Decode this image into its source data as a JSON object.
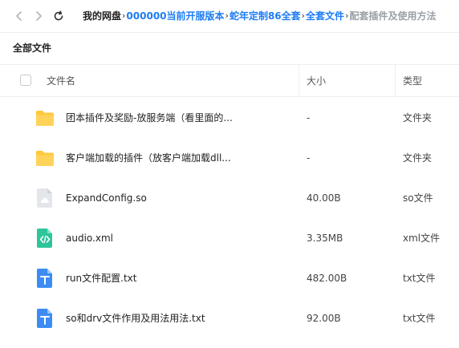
{
  "nav": {
    "back_icon": "chevron-left-icon",
    "forward_icon": "chevron-right-icon",
    "refresh_icon": "refresh-icon",
    "separator": "›",
    "breadcrumb": {
      "root": "我的网盘",
      "items": [
        "000000当前开服版本",
        "蛇年定制86全套",
        "全套文件"
      ],
      "current": "配套插件及使用方法"
    }
  },
  "section_title": "全部文件",
  "table": {
    "headers": {
      "name": "文件名",
      "size": "大小",
      "type": "类型"
    },
    "rows": [
      {
        "icon": "folder-icon",
        "name": "团本插件及奖励-放服务端（看里面的...",
        "size": "-",
        "type": "文件夹"
      },
      {
        "icon": "folder-icon",
        "name": "客户端加载的插件（放客户端加载dll...",
        "size": "-",
        "type": "文件夹"
      },
      {
        "icon": "generic-file-icon",
        "name": "ExpandConfig.so",
        "size": "40.00B",
        "type": "so文件"
      },
      {
        "icon": "code-file-icon",
        "name": "audio.xml",
        "size": "3.35MB",
        "type": "xml文件"
      },
      {
        "icon": "text-file-icon",
        "name": "run文件配置.txt",
        "size": "482.00B",
        "type": "txt文件"
      },
      {
        "icon": "text-file-icon",
        "name": "so和drv文件作用及用法用法.txt",
        "size": "92.00B",
        "type": "txt文件"
      }
    ]
  },
  "colors": {
    "link": "#1c7cf4",
    "folder": "#ffc93d",
    "text_file": "#3b8cf5",
    "code_file": "#2ec59a",
    "generic_file": "#d9dde3"
  }
}
